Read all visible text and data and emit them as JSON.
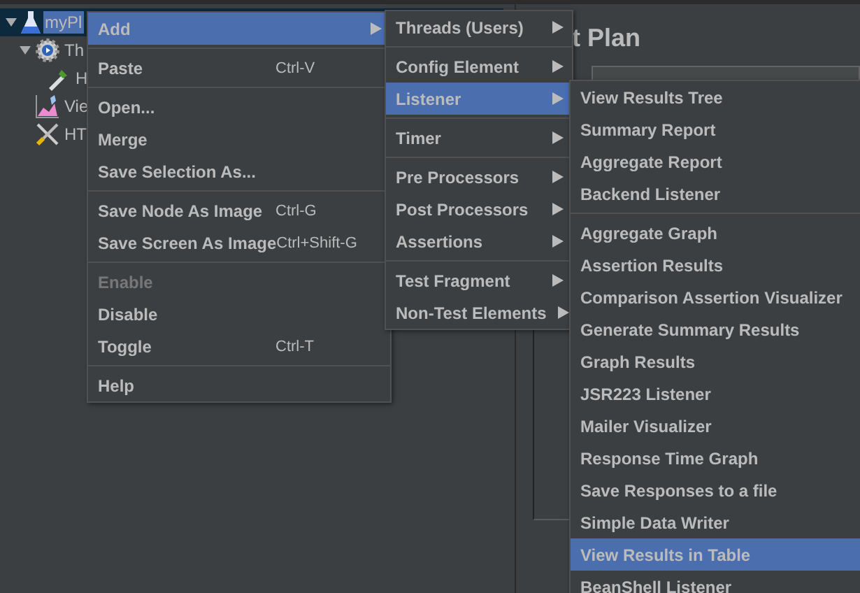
{
  "tree": [
    {
      "label": "myPl",
      "kind": "plan",
      "selected": true,
      "expanded": true,
      "children": [
        {
          "label": "Th",
          "kind": "threads",
          "selected": false,
          "expanded": true,
          "children": [
            {
              "label": "H",
              "kind": "sampler",
              "selected": false
            }
          ]
        },
        {
          "label": "Vie",
          "kind": "listener",
          "selected": false
        },
        {
          "label": "HT",
          "kind": "config",
          "selected": false
        }
      ]
    }
  ],
  "panel": {
    "title": "t Plan"
  },
  "menus": [
    {
      "groups": [
        [
          {
            "label": "Add",
            "submenu": true,
            "selected": true,
            "disabled": false
          }
        ],
        [
          {
            "label": "Paste",
            "shortcut": "Ctrl-V",
            "selected": false,
            "disabled": false
          }
        ],
        [
          {
            "label": "Open...",
            "selected": false,
            "disabled": false
          },
          {
            "label": "Merge",
            "selected": false,
            "disabled": false
          },
          {
            "label": "Save Selection As...",
            "selected": false,
            "disabled": false
          }
        ],
        [
          {
            "label": "Save Node As Image",
            "shortcut": "Ctrl-G",
            "selected": false,
            "disabled": false
          },
          {
            "label": "Save Screen As Image",
            "shortcut": "Ctrl+Shift-G",
            "selected": false,
            "disabled": false
          }
        ],
        [
          {
            "label": "Enable",
            "selected": false,
            "disabled": true
          },
          {
            "label": "Disable",
            "selected": false,
            "disabled": false
          },
          {
            "label": "Toggle",
            "shortcut": "Ctrl-T",
            "selected": false,
            "disabled": false
          }
        ],
        [
          {
            "label": "Help",
            "selected": false,
            "disabled": false
          }
        ]
      ]
    },
    {
      "groups": [
        [
          {
            "label": "Threads (Users)",
            "submenu": true,
            "selected": false,
            "disabled": false
          }
        ],
        [
          {
            "label": "Config Element",
            "submenu": true,
            "selected": false,
            "disabled": false
          },
          {
            "label": "Listener",
            "submenu": true,
            "selected": true,
            "disabled": false
          }
        ],
        [
          {
            "label": "Timer",
            "submenu": true,
            "selected": false,
            "disabled": false
          }
        ],
        [
          {
            "label": "Pre Processors",
            "submenu": true,
            "selected": false,
            "disabled": false
          },
          {
            "label": "Post Processors",
            "submenu": true,
            "selected": false,
            "disabled": false
          },
          {
            "label": "Assertions",
            "submenu": true,
            "selected": false,
            "disabled": false
          }
        ],
        [
          {
            "label": "Test Fragment",
            "submenu": true,
            "selected": false,
            "disabled": false
          },
          {
            "label": "Non-Test Elements",
            "submenu": true,
            "selected": false,
            "disabled": false
          }
        ]
      ]
    },
    {
      "groups": [
        [
          {
            "label": "View Results Tree",
            "selected": false,
            "disabled": false
          },
          {
            "label": "Summary Report",
            "selected": false,
            "disabled": false
          },
          {
            "label": "Aggregate Report",
            "selected": false,
            "disabled": false
          },
          {
            "label": "Backend Listener",
            "selected": false,
            "disabled": false
          }
        ],
        [
          {
            "label": "Aggregate Graph",
            "selected": false,
            "disabled": false
          },
          {
            "label": "Assertion Results",
            "selected": false,
            "disabled": false
          },
          {
            "label": "Comparison Assertion Visualizer",
            "selected": false,
            "disabled": false
          },
          {
            "label": "Generate Summary Results",
            "selected": false,
            "disabled": false
          },
          {
            "label": "Graph Results",
            "selected": false,
            "disabled": false
          },
          {
            "label": "JSR223 Listener",
            "selected": false,
            "disabled": false
          },
          {
            "label": "Mailer Visualizer",
            "selected": false,
            "disabled": false
          },
          {
            "label": "Response Time Graph",
            "selected": false,
            "disabled": false
          },
          {
            "label": "Save Responses to a file",
            "selected": false,
            "disabled": false
          },
          {
            "label": "Simple Data Writer",
            "selected": false,
            "disabled": false
          },
          {
            "label": "View Results in Table",
            "selected": true,
            "disabled": false
          },
          {
            "label": "BeanShell Listener",
            "selected": false,
            "disabled": false
          }
        ]
      ]
    }
  ]
}
